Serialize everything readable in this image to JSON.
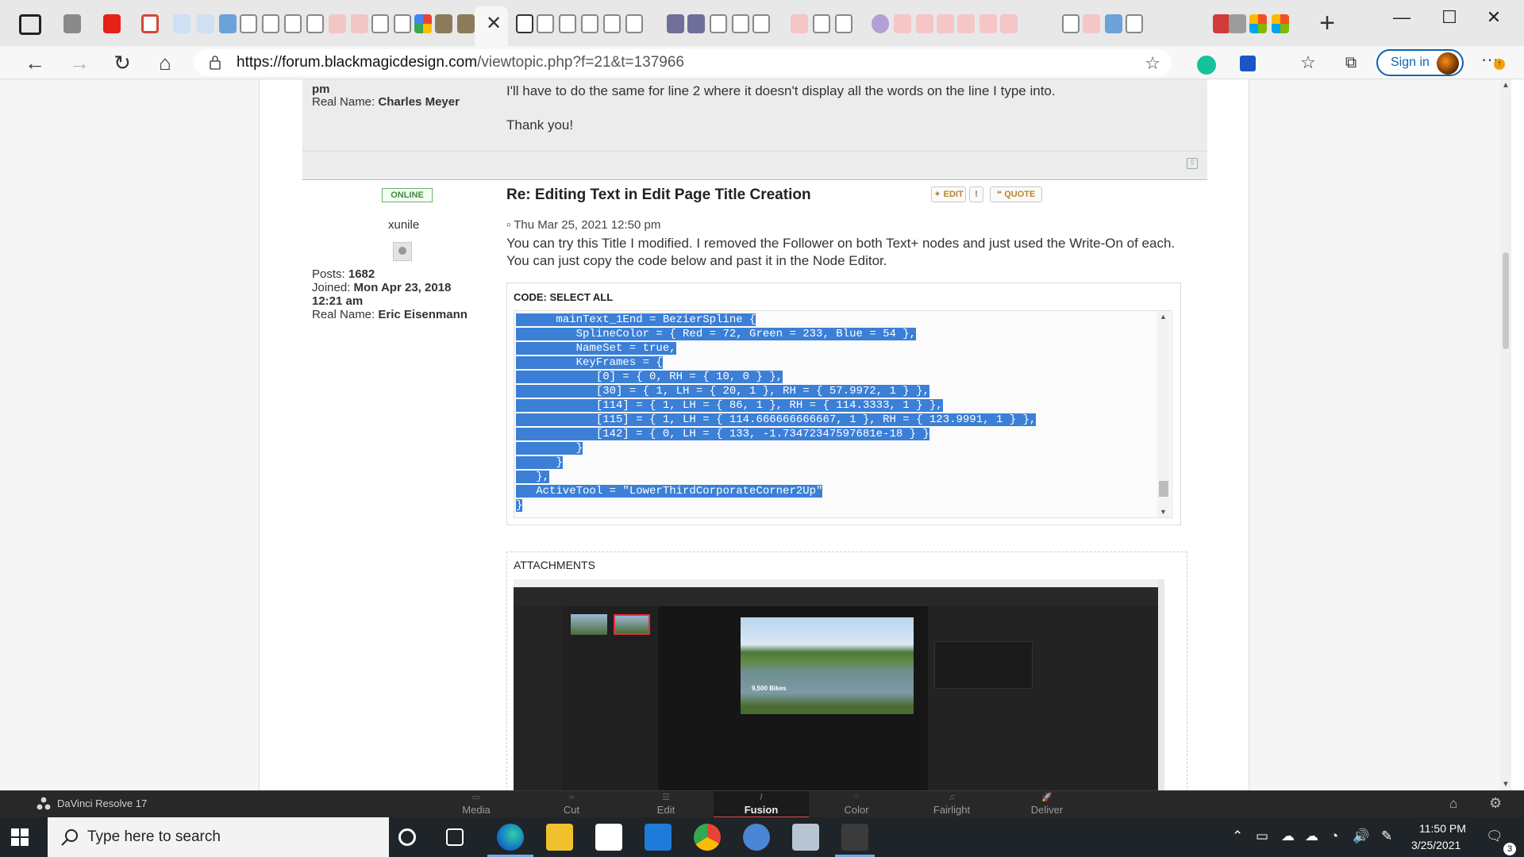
{
  "browser": {
    "url_host": "https://forum.blackmagicdesign.com",
    "url_path": "/viewtopic.php?f=21&t=137966",
    "sign_in_label": "Sign in"
  },
  "previous_post": {
    "profile_fragment": "pm",
    "real_name_label": "Real Name:",
    "real_name": "Charles Meyer",
    "body_line": "I'll have to do the same for line 2 where it doesn't display all the words on the line I type into.",
    "thanks": "Thank you!"
  },
  "post": {
    "status_badge": "ONLINE",
    "author": "xunile",
    "title": "Re: Editing Text in Edit Page Title Creation",
    "edit_label": "EDIT",
    "quote_label": "QUOTE",
    "date": "Thu Mar 25, 2021 12:50 pm",
    "body": "You can try this Title I modified. I removed the Follower on both Text+ nodes and just used the Write-On of each. You can just copy the code below and past it in the Node Editor.",
    "posts_label": "Posts:",
    "posts_count": "1682",
    "joined_label": "Joined:",
    "joined_date": "Mon Apr 23, 2018",
    "joined_time": "12:21 am",
    "real_name_label": "Real Name:",
    "real_name": "Eric Eisenmann"
  },
  "code": {
    "header": "CODE: SELECT ALL",
    "lines": [
      "      mainText_1End = BezierSpline {",
      "         SplineColor = { Red = 72, Green = 233, Blue = 54 },",
      "         NameSet = true,",
      "         KeyFrames = {",
      "            [0] = { 0, RH = { 10, 0 } },",
      "            [30] = { 1, LH = { 20, 1 }, RH = { 57.9972, 1 } },",
      "            [114] = { 1, LH = { 86, 1 }, RH = { 114.3333, 1 } },",
      "            [115] = { 1, LH = { 114.666666666667, 1 }, RH = { 123.9991, 1 } },",
      "            [142] = { 0, LH = { 133, -1.73472347597681e-18 } }",
      "         }",
      "      }",
      "   },",
      "   ActiveTool = \"LowerThirdCorporateCorner2Up\"",
      "}"
    ]
  },
  "attachments": {
    "title": "ATTACHMENTS",
    "video_label": "9,500 Bikes"
  },
  "resolve": {
    "app_name": "DaVinci Resolve 17",
    "pages": [
      "Media",
      "Cut",
      "Edit",
      "Fusion",
      "Color",
      "Fairlight",
      "Deliver"
    ],
    "active_page": "Fusion"
  },
  "taskbar": {
    "search_placeholder": "Type here to search",
    "time": "11:50 PM",
    "date": "3/25/2021",
    "notification_count": "3"
  },
  "colors": {
    "selection": "#3b7fd6",
    "online_green": "#3c8a3c",
    "signin_blue": "#0b63b6",
    "resolve_active_underline": "#e04848"
  }
}
